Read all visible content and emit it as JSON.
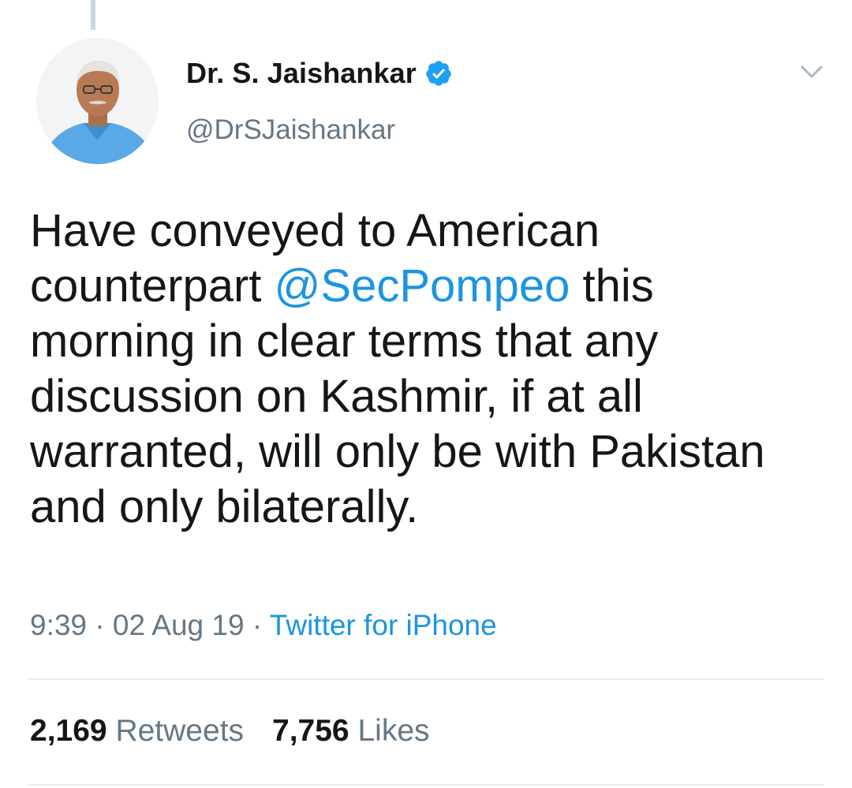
{
  "tweet": {
    "author": {
      "display_name": "Dr. S. Jaishankar",
      "handle": "@DrSJaishankar",
      "verified": true
    },
    "text": {
      "before_mention": "Have conveyed to American counterpart ",
      "mention": "@SecPompeo",
      "after_mention": " this morning in clear terms that any discussion on Kashmir, if at all warranted, will only be with Pakistan and only bilaterally."
    },
    "meta": {
      "time": "9:39",
      "separator": " · ",
      "date": "02 Aug 19",
      "source": "Twitter for iPhone"
    },
    "stats": {
      "retweets_count": "2,169",
      "retweets_label": "Retweets",
      "likes_count": "7,756",
      "likes_label": "Likes"
    }
  },
  "icons": {
    "verified": "verified-badge-icon",
    "menu": "chevron-down-icon"
  },
  "colors": {
    "link": "#1b95e0",
    "secondary_text": "#657786",
    "primary_text": "#14171a",
    "divider": "#e6ecf0",
    "verified_badge": "#1da1f2"
  }
}
